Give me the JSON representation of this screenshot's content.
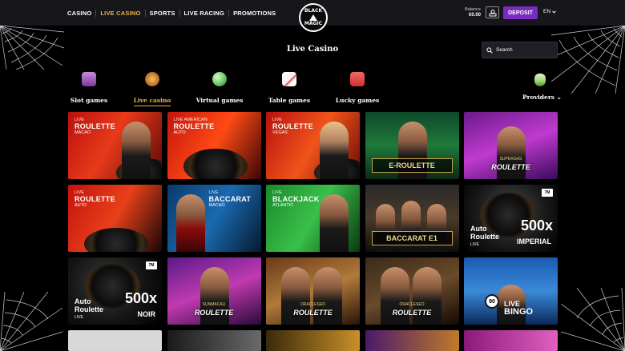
{
  "nav": {
    "items": [
      {
        "label": "CASINO",
        "active": false
      },
      {
        "label": "LIVE CASINO",
        "active": true
      },
      {
        "label": "SPORTS",
        "active": false
      },
      {
        "label": "LIVE RACING",
        "active": false
      },
      {
        "label": "PROMOTIONS",
        "active": false
      }
    ]
  },
  "logo": {
    "line1": "BLACK",
    "line2": "MAGIC"
  },
  "account": {
    "balance_label": "Balance",
    "balance_value": "€0.00",
    "deposit_label": "DEPOSIT",
    "language": "EN"
  },
  "page": {
    "title": "Live Casino"
  },
  "search": {
    "placeholder": "Search"
  },
  "categories": [
    {
      "label": "Slot games",
      "icon": "slot-machine-icon",
      "active": false
    },
    {
      "label": "Live casino",
      "icon": "roulette-chip-icon",
      "active": true
    },
    {
      "label": "Virtual games",
      "icon": "globe-icon",
      "active": false
    },
    {
      "label": "Table games",
      "icon": "playing-cards-icon",
      "active": false
    },
    {
      "label": "Lucky games",
      "icon": "gift-box-icon",
      "active": false
    }
  ],
  "providers": {
    "label": "Providers",
    "icon": "potion-icon"
  },
  "colors": {
    "accent": "#e8b24a",
    "deposit": "#7a2cc0",
    "header": "#16161b"
  },
  "games": [
    {
      "small": "LIVE",
      "big": "ROULETTE",
      "sub": "MACAO"
    },
    {
      "small": "LIVE AMERICAN",
      "big": "ROULETTE",
      "sub": "AUTO"
    },
    {
      "small": "LIVE",
      "big": "ROULETTE",
      "sub": "VEGAS"
    },
    {
      "banner": "E-ROULETTE"
    },
    {
      "brand_sub": "SUPERGAS",
      "brand": "ROULETTE"
    },
    {
      "small": "LIVE",
      "big": "ROULETTE",
      "sub": "AUTO"
    },
    {
      "small": "LIVE",
      "big": "BACCARAT",
      "sub": "MACAO"
    },
    {
      "small": "LIVE",
      "big": "BLACKJACK",
      "sub": "ATLANTIC"
    },
    {
      "banner": "BACCARAT E1"
    },
    {
      "auto": "Auto",
      "auto2": "Roulette",
      "live": "LIVE",
      "mult": "500x",
      "mult_sub": "IMPERIAL",
      "logo": "7M"
    },
    {
      "auto": "Auto",
      "auto2": "Roulette",
      "live": "LIVE",
      "mult": "500x",
      "mult_sub": "NOIR",
      "logo": "7M"
    },
    {
      "brand_sub": "SUNMACAU",
      "brand": "ROULETTE"
    },
    {
      "brand_sub": "ORACLESEO",
      "brand": "ROULETTE"
    },
    {
      "brand_sub": "ORACLESEO",
      "brand": "ROULETTE"
    },
    {
      "number": "90",
      "big_live": "LIVE",
      "bingo": "BINGO"
    }
  ]
}
